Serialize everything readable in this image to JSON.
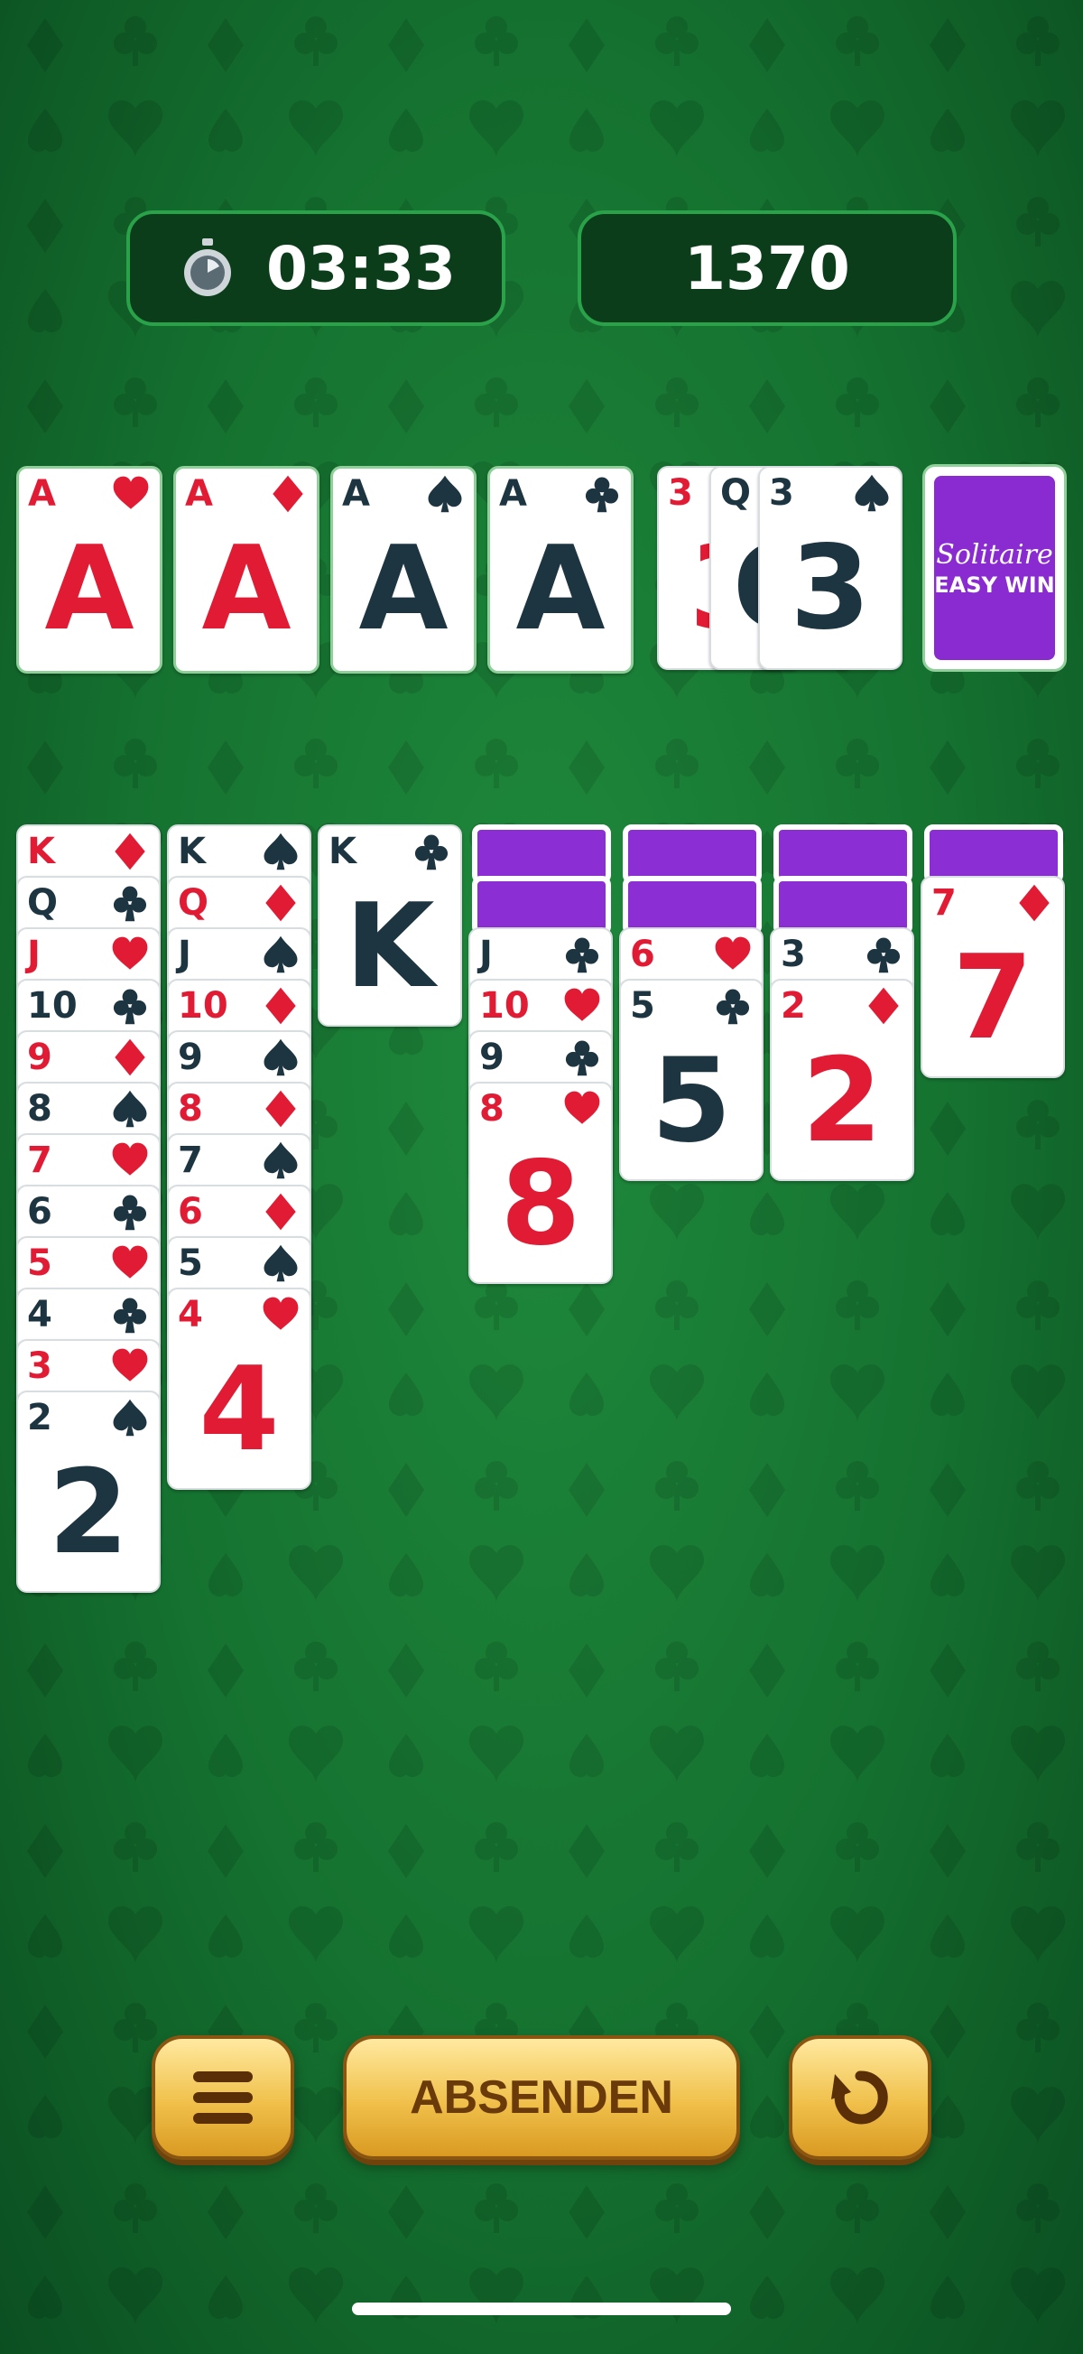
{
  "timer": "03:33",
  "score": "1370",
  "foundations": [
    {
      "rank": "A",
      "suit": "heart"
    },
    {
      "rank": "A",
      "suit": "diamond"
    },
    {
      "rank": "A",
      "suit": "spade"
    },
    {
      "rank": "A",
      "suit": "club"
    }
  ],
  "waste": [
    {
      "rank": "3",
      "suit": "heart"
    },
    {
      "rank": "Q",
      "suit": "spade"
    },
    {
      "rank": "3",
      "suit": "spade"
    }
  ],
  "stock": {
    "brand_line1": "Solitaire",
    "brand_line2": "EASY WIN"
  },
  "tableau": [
    {
      "hidden": 0,
      "cards": [
        {
          "rank": "K",
          "suit": "diamond"
        },
        {
          "rank": "Q",
          "suit": "club"
        },
        {
          "rank": "J",
          "suit": "heart"
        },
        {
          "rank": "10",
          "suit": "club"
        },
        {
          "rank": "9",
          "suit": "diamond"
        },
        {
          "rank": "8",
          "suit": "spade"
        },
        {
          "rank": "7",
          "suit": "heart"
        },
        {
          "rank": "6",
          "suit": "club"
        },
        {
          "rank": "5",
          "suit": "heart"
        },
        {
          "rank": "4",
          "suit": "club"
        },
        {
          "rank": "3",
          "suit": "heart"
        },
        {
          "rank": "2",
          "suit": "spade"
        }
      ]
    },
    {
      "hidden": 0,
      "cards": [
        {
          "rank": "K",
          "suit": "spade"
        },
        {
          "rank": "Q",
          "suit": "diamond"
        },
        {
          "rank": "J",
          "suit": "spade"
        },
        {
          "rank": "10",
          "suit": "diamond"
        },
        {
          "rank": "9",
          "suit": "spade"
        },
        {
          "rank": "8",
          "suit": "diamond"
        },
        {
          "rank": "7",
          "suit": "spade"
        },
        {
          "rank": "6",
          "suit": "diamond"
        },
        {
          "rank": "5",
          "suit": "spade"
        },
        {
          "rank": "4",
          "suit": "heart"
        }
      ]
    },
    {
      "hidden": 0,
      "cards": [
        {
          "rank": "K",
          "suit": "club"
        }
      ]
    },
    {
      "hidden": 2,
      "cards": [
        {
          "rank": "J",
          "suit": "club"
        },
        {
          "rank": "10",
          "suit": "heart"
        },
        {
          "rank": "9",
          "suit": "club"
        },
        {
          "rank": "8",
          "suit": "heart"
        }
      ]
    },
    {
      "hidden": 2,
      "cards": [
        {
          "rank": "6",
          "suit": "heart"
        },
        {
          "rank": "5",
          "suit": "club"
        }
      ]
    },
    {
      "hidden": 2,
      "cards": [
        {
          "rank": "3",
          "suit": "club"
        },
        {
          "rank": "2",
          "suit": "diamond"
        }
      ]
    },
    {
      "hidden": 1,
      "cards": [
        {
          "rank": "7",
          "suit": "diamond"
        }
      ]
    }
  ],
  "buttons": {
    "menu_icon": "menu-icon",
    "submit": "ABSENDEN",
    "undo_icon": "undo-icon"
  },
  "colors": {
    "red": "#e11b33",
    "black": "#1d3441",
    "card_back": "#8b2ed4",
    "felt": "#157230",
    "button_gold": "#f0c04a"
  }
}
